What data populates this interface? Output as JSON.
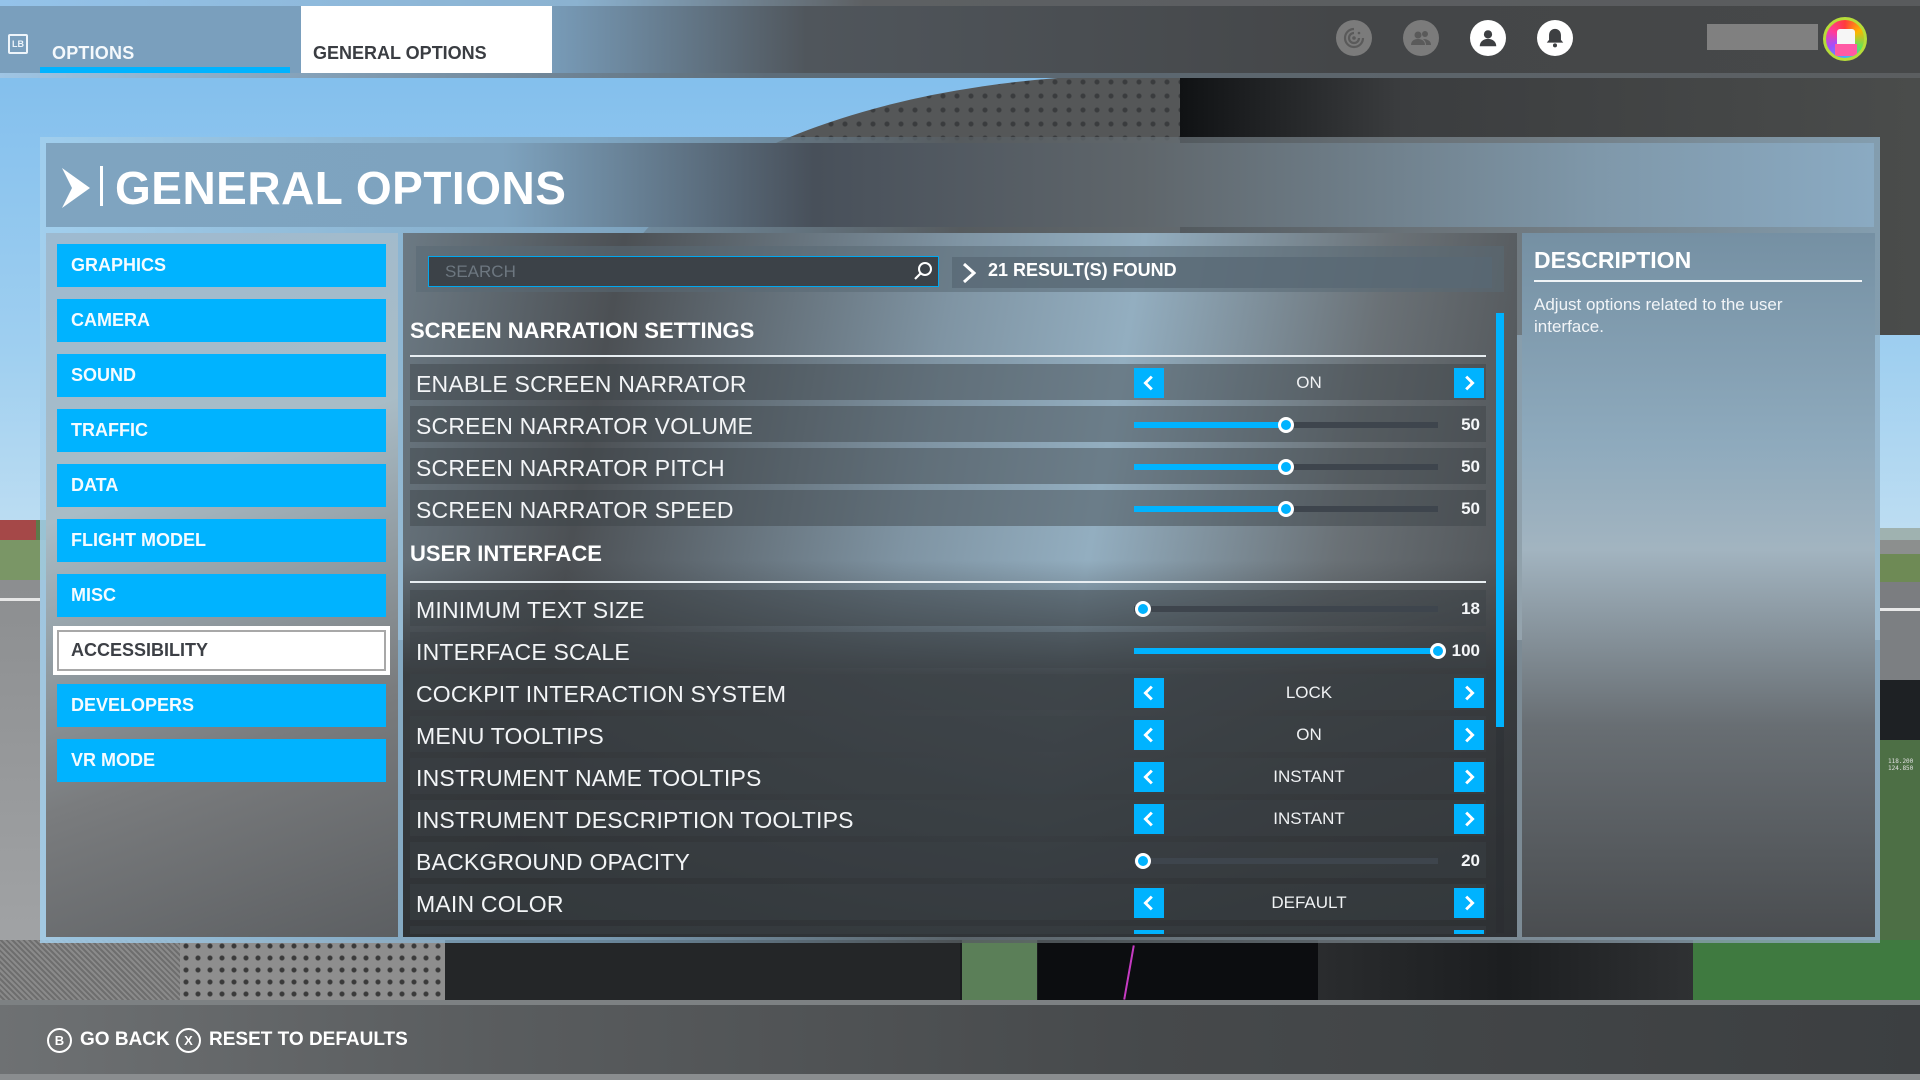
{
  "topbar": {
    "lb_badge": "LB",
    "tabs": [
      {
        "label": "OPTIONS",
        "active": false
      },
      {
        "label": "GENERAL OPTIONS",
        "active": true
      }
    ],
    "icons": [
      "activity-icon",
      "friends-icon",
      "profile-icon",
      "notifications-icon"
    ]
  },
  "page": {
    "title": "GENERAL OPTIONS"
  },
  "sidebar": {
    "items": [
      {
        "label": "GRAPHICS"
      },
      {
        "label": "CAMERA"
      },
      {
        "label": "SOUND"
      },
      {
        "label": "TRAFFIC"
      },
      {
        "label": "DATA"
      },
      {
        "label": "FLIGHT MODEL"
      },
      {
        "label": "MISC"
      },
      {
        "label": "ACCESSIBILITY",
        "active": true
      },
      {
        "label": "DEVELOPERS"
      },
      {
        "label": "VR MODE"
      }
    ]
  },
  "search": {
    "placeholder": "SEARCH",
    "value": "",
    "results": "21 RESULT(S) FOUND"
  },
  "sections": [
    {
      "title": "SCREEN NARRATION SETTINGS",
      "rows": [
        {
          "label": "ENABLE SCREEN NARRATOR",
          "type": "choice",
          "value": "ON"
        },
        {
          "label": "SCREEN NARRATOR VOLUME",
          "type": "slider",
          "value": 50,
          "min": 0,
          "max": 100
        },
        {
          "label": "SCREEN NARRATOR PITCH",
          "type": "slider",
          "value": 50,
          "min": 0,
          "max": 100
        },
        {
          "label": "SCREEN NARRATOR SPEED",
          "type": "slider",
          "value": 50,
          "min": 0,
          "max": 100
        }
      ]
    },
    {
      "title": "USER INTERFACE",
      "rows": [
        {
          "label": "MINIMUM TEXT SIZE",
          "type": "slider",
          "value": 18,
          "min": 18,
          "max": 100
        },
        {
          "label": "INTERFACE SCALE",
          "type": "slider",
          "value": 100,
          "min": 0,
          "max": 100
        },
        {
          "label": "COCKPIT INTERACTION SYSTEM",
          "type": "choice",
          "value": "LOCK"
        },
        {
          "label": "MENU TOOLTIPS",
          "type": "choice",
          "value": "ON"
        },
        {
          "label": "INSTRUMENT NAME TOOLTIPS",
          "type": "choice",
          "value": "INSTANT"
        },
        {
          "label": "INSTRUMENT DESCRIPTION TOOLTIPS",
          "type": "choice",
          "value": "INSTANT"
        },
        {
          "label": "BACKGROUND OPACITY",
          "type": "slider",
          "value": 20,
          "min": 20,
          "max": 100
        },
        {
          "label": "MAIN COLOR",
          "type": "choice",
          "value": "DEFAULT"
        }
      ]
    }
  ],
  "scroll": {
    "visible_fraction": 0.67,
    "position": 0
  },
  "description": {
    "title": "DESCRIPTION",
    "text": "Adjust options related to the user interface."
  },
  "footer": {
    "actions": [
      {
        "glyph": "B",
        "label": "GO BACK"
      },
      {
        "glyph": "X",
        "label": "RESET TO DEFAULTS"
      }
    ]
  },
  "background": {
    "frequencies": [
      "118.200",
      "124.850"
    ]
  },
  "colors": {
    "accent": "#00b3ff",
    "selected_item_bg": "#ffffff",
    "avatar_ring": "#b6dc3a"
  }
}
